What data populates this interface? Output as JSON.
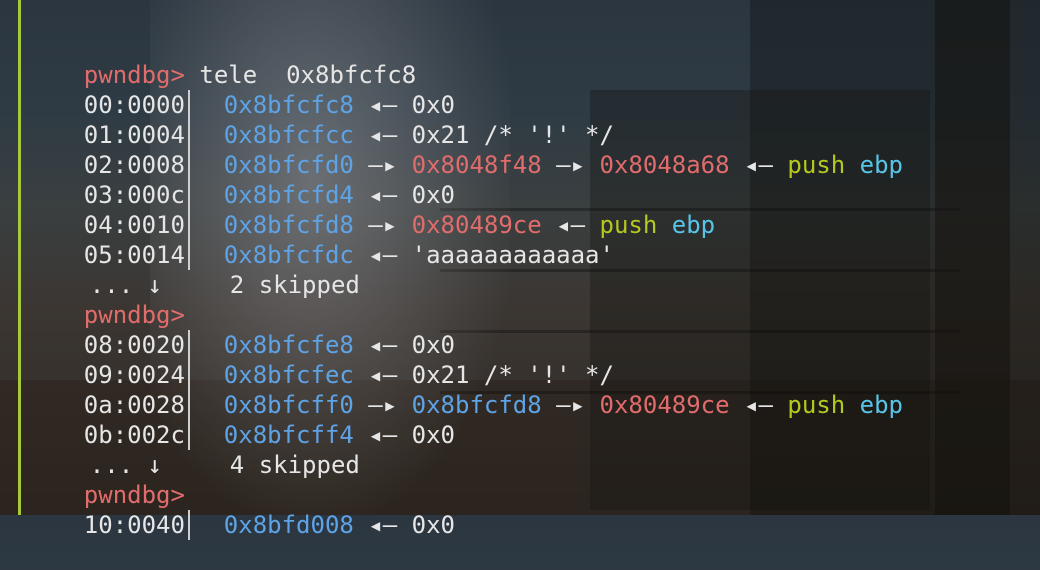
{
  "prompt": "pwndbg>",
  "command": "tele  0x8bfcfc8",
  "arrow_left": "◂—",
  "arrow_right": "—▸",
  "skip_marker": "... ↓",
  "rows": [
    {
      "off": "00:0000",
      "addr": "0x8bfcfc8",
      "tail": "0x0"
    },
    {
      "off": "01:0004",
      "addr": "0x8bfcfcc",
      "tail": "0x21 /* '!' */"
    },
    {
      "off": "02:0008",
      "addr": "0x8bfcfd0",
      "ptr1": "0x8048f48",
      "ptr2": "0x8048a68",
      "instr": "push",
      "reg": "ebp"
    },
    {
      "off": "03:000c",
      "addr": "0x8bfcfd4",
      "tail": "0x0"
    },
    {
      "off": "04:0010",
      "addr": "0x8bfcfd8",
      "ptr1": "0x80489ce",
      "instr": "push",
      "reg": "ebp"
    },
    {
      "off": "05:0014",
      "addr": "0x8bfcfdc",
      "tail": "'aaaaaaaaaaaa'"
    },
    {
      "skip": "2 skipped"
    },
    {
      "off": "08:0020",
      "addr": "0x8bfcfe8",
      "tail": "0x0"
    },
    {
      "off": "09:0024",
      "addr": "0x8bfcfec",
      "tail": "0x21 /* '!' */"
    },
    {
      "off": "0a:0028",
      "addr": "0x8bfcff0",
      "ptr1": "0x8bfcfd8",
      "ptr2": "0x80489ce",
      "instr": "push",
      "reg": "ebp"
    },
    {
      "off": "0b:002c",
      "addr": "0x8bfcff4",
      "tail": "0x0"
    },
    {
      "skip": "4 skipped"
    },
    {
      "off": "10:0040",
      "addr": "0x8bfd008",
      "tail": "0x0"
    }
  ]
}
